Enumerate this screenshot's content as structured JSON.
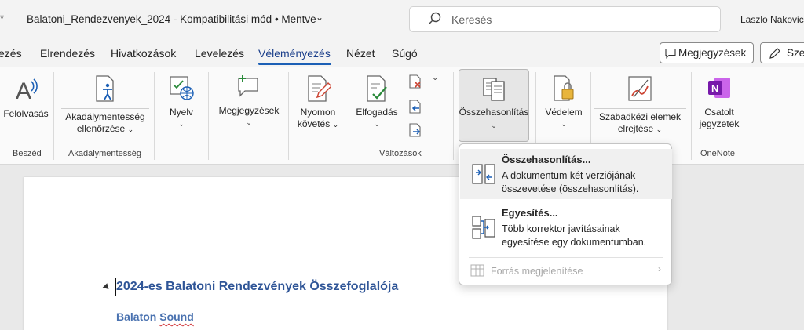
{
  "titlebar": {
    "doc_title": "Balatoni_Rendezvenyek_2024  -  Kompatibilitási mód • Mentve",
    "search_placeholder": "Keresés",
    "user": "Laszlo Nakovics"
  },
  "tabs": [
    "ezés",
    "Elrendezés",
    "Hivatkozások",
    "Levelezés",
    "Véleményezés",
    "Nézet",
    "Súgó"
  ],
  "active_tab": "Véleményezés",
  "header_buttons": {
    "comments": "Megjegyzések",
    "edit": "Szerk"
  },
  "ribbon": {
    "read_aloud": "Felolvasás",
    "accessibility_line1": "Akadálymentesség",
    "accessibility_line2": "ellenőrzése",
    "language": "Nyelv",
    "comments": "Megjegyzések",
    "track_line1": "Nyomon",
    "track_line2": "követés",
    "accept": "Elfogadás",
    "compare": "Összehasonlítás",
    "protect": "Védelem",
    "ink_line1": "Szabadkézi elemek",
    "ink_line2": "elrejtése",
    "notes_line1": "Csatolt",
    "notes_line2": "jegyzetek",
    "groups": {
      "speech": "Beszéd",
      "accessibility": "Akadálymentesség",
      "changes": "Változások",
      "onenote": "OneNote"
    }
  },
  "dropdown": {
    "compare_title": "Összehasonlítás...",
    "compare_desc1": "A dokumentum két verziójának",
    "compare_desc2": "összevetése (összehasonlítás).",
    "combine_title": "Egyesítés...",
    "combine_desc1": "Több korrektor javításainak",
    "combine_desc2": "egyesítése egy dokumentumban.",
    "source": "Forrás megjelenítése"
  },
  "document": {
    "heading1": "2024-es Balatoni Rendezvények Összefoglalója",
    "heading2_a": "Balaton ",
    "heading2_b": "Sound"
  },
  "colors": {
    "accent": "#1b5fb5",
    "heading": "#2f5597",
    "onenote": "#7719aa"
  }
}
